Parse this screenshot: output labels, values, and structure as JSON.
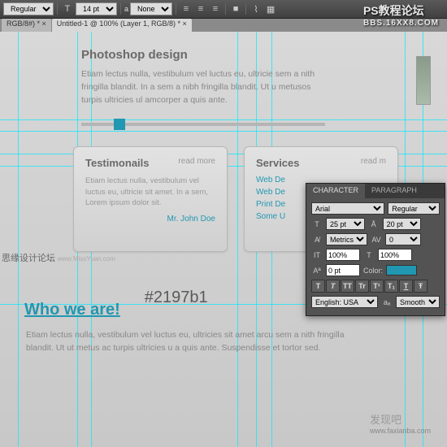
{
  "toolbar": {
    "weight": "Regular",
    "sizeIcon": "T",
    "size": "14 pt",
    "aa": "a",
    "aaMode": "None"
  },
  "tabs": [
    "RGB/8#) * ×",
    "Untitled-1 @ 100% (Layer 1, RGB/8) * ×"
  ],
  "hero": {
    "title": "Photoshop design",
    "body": "Etiam lectus nulla, vestibulum vel luctus eu, ultricie sem a nith fringilla blandit. In a sem a nibh fringilla blandit. Ut u metusos turpis ultricies ul amcorper a quis ante."
  },
  "cards": {
    "t": {
      "title": "Testimonails",
      "more": "read more",
      "body": "Etiam lectus nulla, vestibulum vel luctus eu, ultricie sit amet. In a sem, Lorem ipsum dolor sit.",
      "author": "Mr. John Doe"
    },
    "s": {
      "title": "Services",
      "more": "read m",
      "links": [
        "Web De",
        "Web De",
        "Print De",
        "Some U"
      ]
    }
  },
  "who": {
    "heading": "Who we are!",
    "hex": "#2197b1",
    "body": "Etiam lectus nulla, vestibulum vel luctus eu, ultricies sit amet arcu sem a nith fringilla blandit. Ut ut metus ac turpis ultricies u a quis ante. Suspendisse et tortor sed."
  },
  "watermarks": {
    "tr1": "PS教程论坛",
    "tr2": "BBS.16XX8.COM",
    "l": "思缘设计论坛",
    "lurl": "www.MissYuan.com",
    "br": "发现吧",
    "brurl": "www.faxianba.com"
  },
  "char": {
    "tabs": [
      "CHARACTER",
      "PARAGRAPH"
    ],
    "font": "Arial",
    "weight": "Regular",
    "size": "25 pt",
    "leading": "20 pt",
    "kern": "Metrics",
    "track": "0",
    "vscale": "100%",
    "hscale": "100%",
    "baseline": "0 pt",
    "colorLabel": "Color:",
    "lang": "English: USA",
    "aa": "Smooth",
    "btns": [
      "T",
      "T",
      "TT",
      "Tr",
      "T¹",
      "T₁",
      "T",
      "Ŧ"
    ]
  }
}
